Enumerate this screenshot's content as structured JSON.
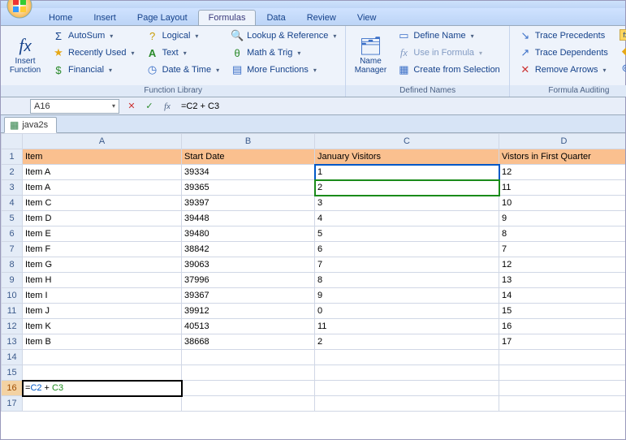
{
  "tabs": {
    "home": "Home",
    "insert": "Insert",
    "pagelayout": "Page Layout",
    "formulas": "Formulas",
    "data": "Data",
    "review": "Review",
    "view": "View"
  },
  "ribbon": {
    "insert_function": "Insert\nFunction",
    "autosum": "AutoSum",
    "recent": "Recently Used",
    "financial": "Financial",
    "logical": "Logical",
    "text": "Text",
    "datetime": "Date & Time",
    "lookup": "Lookup & Reference",
    "mathtrig": "Math & Trig",
    "more": "More Functions",
    "group_funclib": "Function Library",
    "name_manager": "Name\nManager",
    "define_name": "Define Name",
    "use_in_formula": "Use in Formula",
    "create_selection": "Create from Selection",
    "group_defnames": "Defined Names",
    "trace_prec": "Trace Precedents",
    "trace_dep": "Trace Dependents",
    "remove_arrows": "Remove Arrows",
    "group_audit": "Formula Auditing"
  },
  "fbar": {
    "namebox": "A16",
    "formula": "=C2 + C3"
  },
  "workbook": {
    "name": "java2s"
  },
  "columns": {
    "A": "A",
    "B": "B",
    "C": "C",
    "D": "D"
  },
  "headers": {
    "A": "Item",
    "B": "Start Date",
    "C": "January Visitors",
    "D": "Vistors in First Quarter"
  },
  "rows": [
    {
      "n": "1"
    },
    {
      "n": "2",
      "A": "Item A",
      "B": "39334",
      "C": "1",
      "D": "12"
    },
    {
      "n": "3",
      "A": "Item A",
      "B": "39365",
      "C": "2",
      "D": "11"
    },
    {
      "n": "4",
      "A": "Item C",
      "B": "39397",
      "C": "3",
      "D": "10"
    },
    {
      "n": "5",
      "A": "Item D",
      "B": "39448",
      "C": "4",
      "D": "9"
    },
    {
      "n": "6",
      "A": "Item E",
      "B": "39480",
      "C": "5",
      "D": "8"
    },
    {
      "n": "7",
      "A": "Item F",
      "B": "38842",
      "C": "6",
      "D": "7"
    },
    {
      "n": "8",
      "A": "Item G",
      "B": "39063",
      "C": "7",
      "D": "12"
    },
    {
      "n": "9",
      "A": "Item H",
      "B": "37996",
      "C": "8",
      "D": "13"
    },
    {
      "n": "10",
      "A": "Item I",
      "B": "39367",
      "C": "9",
      "D": "14"
    },
    {
      "n": "11",
      "A": "Item J",
      "B": "39912",
      "C": "0",
      "D": "15"
    },
    {
      "n": "12",
      "A": "Item K",
      "B": "40513",
      "C": "11",
      "D": "16"
    },
    {
      "n": "13",
      "A": "Item B",
      "B": "38668",
      "C": "2",
      "D": "17"
    },
    {
      "n": "14"
    },
    {
      "n": "15"
    },
    {
      "n": "16"
    },
    {
      "n": "17"
    }
  ],
  "edit": {
    "prefix": "=",
    "ref1": "C2",
    "mid": " + ",
    "ref2": "C3"
  }
}
